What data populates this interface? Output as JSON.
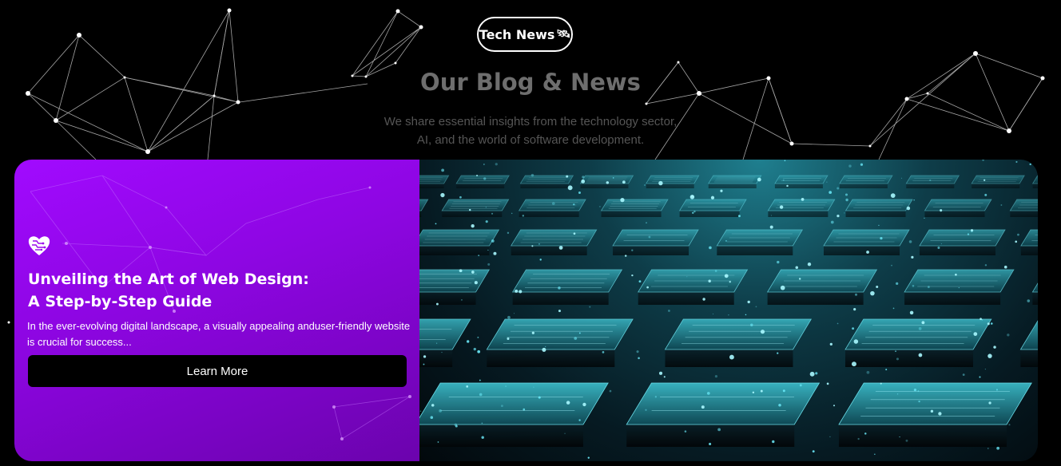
{
  "badge": {
    "label": "Tech News",
    "icon": "satellite-icon"
  },
  "section": {
    "title": "Our Blog & News",
    "subtitle_line1": "We share essential insights from the technology sector,",
    "subtitle_line2": "AI, and the world of software development."
  },
  "featured_post": {
    "icon": "heart-circuit-icon",
    "title_line1": "Unveiling the Art of Web Design:",
    "title_line2": "A Step-by-Step Guide",
    "excerpt": "In the ever-evolving digital landscape, a visually appealing anduser-friendly website is crucial for success...",
    "button_label": "Learn More",
    "image": "circuit-board-hero-image"
  },
  "colors": {
    "background": "#000000",
    "card_purple": "#9306e8",
    "accent_cyan": "#39d6e6"
  }
}
